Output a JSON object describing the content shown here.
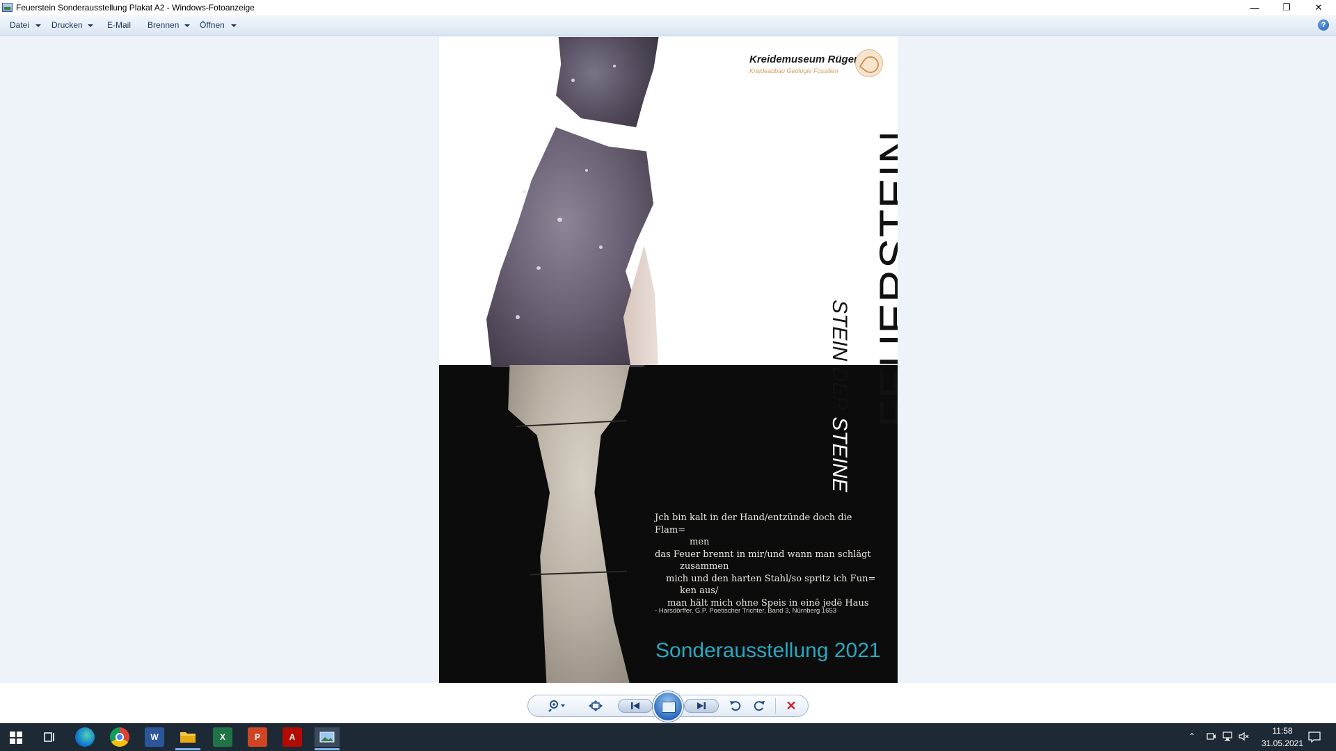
{
  "window": {
    "title": "Feuerstein Sonderausstellung Plakat A2 - Windows-Fotoanzeige",
    "minimize_glyph": "—",
    "maximize_glyph": "❐",
    "close_glyph": "✕"
  },
  "menu": {
    "items": [
      {
        "label": "Datei",
        "dropdown": true
      },
      {
        "label": "Drucken",
        "dropdown": true
      },
      {
        "label": "E-Mail",
        "dropdown": false
      },
      {
        "label": "Brennen",
        "dropdown": true
      },
      {
        "label": "Öffnen",
        "dropdown": true
      }
    ],
    "help_glyph": "?"
  },
  "poster": {
    "museum_name": "Kreidemuseum Rügen",
    "museum_tagline": "Kreideabbau Geologie Fossilien",
    "title": "FEUERSTEIN",
    "subtitle_light": "STEIN DER",
    "subtitle_dark": " STEINE",
    "quote_lines": [
      "Jch bin kalt in der Hand/entzünde doch die Flam=",
      "men",
      "das Feuer brennt in mir/und wann man schlägt",
      "zusammen",
      "mich und den harten Stahl/so spritz ich Fun=",
      "ken aus/",
      "man hält mich ohne Speis in einē jedē Haus"
    ],
    "attribution": "- Harsdörffer, G.P. Poetischer Trichter, Band 3, Nürnberg 1653",
    "exhibition": "Sonderausstellung 2021"
  },
  "toolbar": {
    "zoom_icon": "zoom-icon",
    "fit_icon": "fit-to-window-icon",
    "previous_icon": "previous-icon",
    "slideshow_icon": "slideshow-icon",
    "next_icon": "next-icon",
    "rotate_left_icon": "rotate-counterclockwise-icon",
    "rotate_right_icon": "rotate-clockwise-icon",
    "delete_icon": "delete-icon"
  },
  "taskbar": {
    "apps": [
      "start",
      "task-view",
      "edge",
      "chrome",
      "word",
      "file-explorer",
      "excel",
      "powerpoint",
      "acrobat",
      "photo-viewer"
    ],
    "time": "11:58",
    "date": "31.05.2021"
  },
  "colors": {
    "exhibition_text": "#2aa8c0",
    "museum_tagline": "#d99a58",
    "taskbar": "#1d2935",
    "viewer_background": "#eef3fa"
  }
}
